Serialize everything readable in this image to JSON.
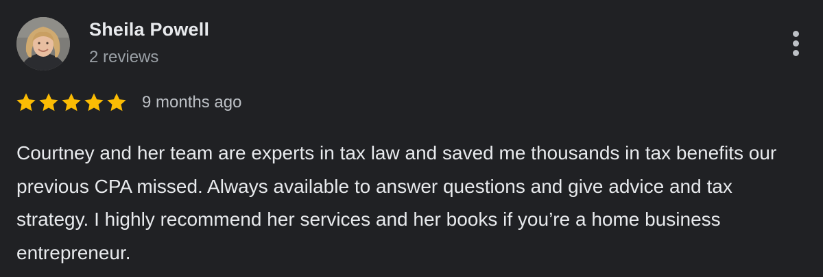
{
  "reviewer": {
    "name": "Sheila Powell",
    "review_count": "2 reviews"
  },
  "review": {
    "rating": 5,
    "max_rating": 5,
    "date": "9 months ago",
    "text": "Courtney and her team are experts in tax law and saved me thousands in tax benefits our previous CPA missed. Always available to answer questions and give advice and tax strategy. I highly recommend her services and her books if you’re a home business entrepreneur."
  },
  "icons": {
    "menu": "more-vert-icon",
    "star": "star-icon"
  },
  "colors": {
    "background": "#202124",
    "star": "#fbbc04",
    "primary_text": "#e8eaed",
    "secondary_text": "#9aa0a6"
  }
}
